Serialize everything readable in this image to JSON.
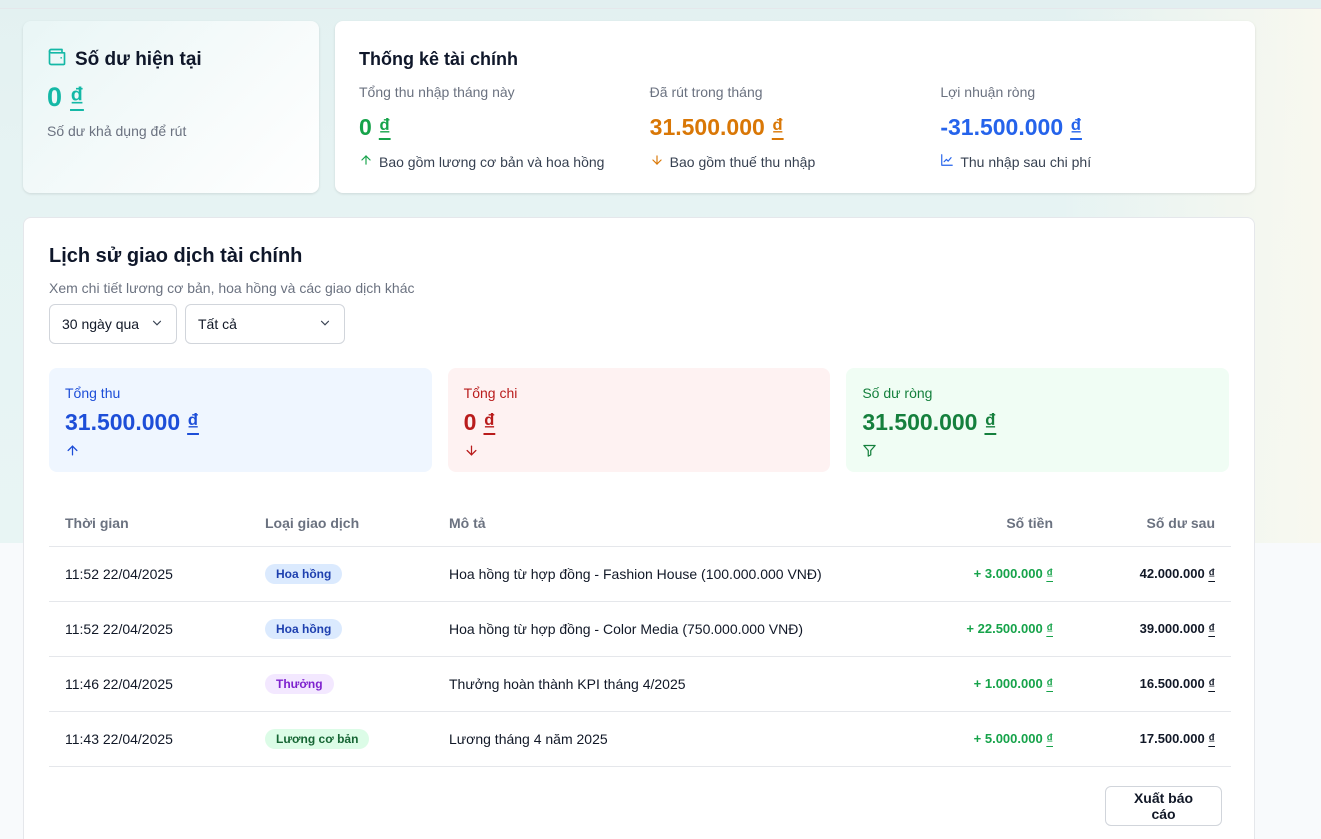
{
  "balance": {
    "title": "Số dư hiện tại",
    "amount": "0",
    "currency": "₫",
    "subtitle": "Số dư khả dụng để rút",
    "icon": "wallet-icon",
    "accent": "#14b8a6"
  },
  "stats": {
    "title": "Thống kê tài chính",
    "items": [
      {
        "label": "Tổng thu nhập tháng này",
        "value": "0",
        "currency": "₫",
        "note": "Bao gồm lương cơ bản và hoa hồng",
        "icon": "arrow-up-icon",
        "color": "#16a34a"
      },
      {
        "label": "Đã rút trong tháng",
        "value": "31.500.000",
        "currency": "₫",
        "note": "Bao gồm thuế thu nhập",
        "icon": "arrow-down-icon",
        "color": "#d97706"
      },
      {
        "label": "Lợi nhuận ròng",
        "value": "-31.500.000",
        "currency": "₫",
        "note": "Thu nhập sau chi phí",
        "icon": "line-chart-icon",
        "color": "#2563eb"
      }
    ]
  },
  "history": {
    "title": "Lịch sử giao dịch tài chính",
    "subtitle": "Xem chi tiết lương cơ bản, hoa hồng và các giao dịch khác",
    "filters": [
      {
        "value": "30 ngày qua"
      },
      {
        "value": "Tất cả"
      }
    ],
    "summary": [
      {
        "label": "Tổng thu",
        "value": "31.500.000",
        "currency": "₫",
        "icon": "arrow-up-icon",
        "bg": "#eff6ff",
        "color": "#1d4ed8"
      },
      {
        "label": "Tổng chi",
        "value": "0",
        "currency": "₫",
        "icon": "arrow-down-icon",
        "bg": "#fef2f2",
        "color": "#b91c1c"
      },
      {
        "label": "Số dư ròng",
        "value": "31.500.000",
        "currency": "₫",
        "icon": "filter-icon",
        "bg": "#f0fdf4",
        "color": "#15803d"
      }
    ],
    "columns": [
      "Thời gian",
      "Loại giao dịch",
      "Mô tả",
      "Số tiền",
      "Số dư sau"
    ],
    "rows": [
      {
        "time": "11:52 22/04/2025",
        "type": "Hoa hồng",
        "desc": "Hoa hồng từ hợp đồng - Fashion House (100.000.000 VNĐ)",
        "amount": "+ 3.000.000",
        "currency": "₫",
        "after": "42.000.000"
      },
      {
        "time": "11:52 22/04/2025",
        "type": "Hoa hồng",
        "desc": "Hoa hồng từ hợp đồng - Color Media (750.000.000 VNĐ)",
        "amount": "+ 22.500.000",
        "currency": "₫",
        "after": "39.000.000"
      },
      {
        "time": "11:46 22/04/2025",
        "type": "Thưởng",
        "desc": "Thưởng hoàn thành KPI tháng 4/2025",
        "amount": "+ 1.000.000",
        "currency": "₫",
        "after": "16.500.000"
      },
      {
        "time": "11:43 22/04/2025",
        "type": "Lương cơ bản",
        "desc": "Lương tháng 4 năm 2025",
        "amount": "+ 5.000.000",
        "currency": "₫",
        "after": "17.500.000"
      }
    ],
    "badge_styles": {
      "Hoa hồng": {
        "bg": "#dbeafe",
        "color": "#1e40af"
      },
      "Thưởng": {
        "bg": "#f3e8ff",
        "color": "#7e22ce"
      },
      "Lương cơ bản": {
        "bg": "#dcfce7",
        "color": "#166534"
      }
    },
    "export_label": "Xuất báo cáo"
  }
}
